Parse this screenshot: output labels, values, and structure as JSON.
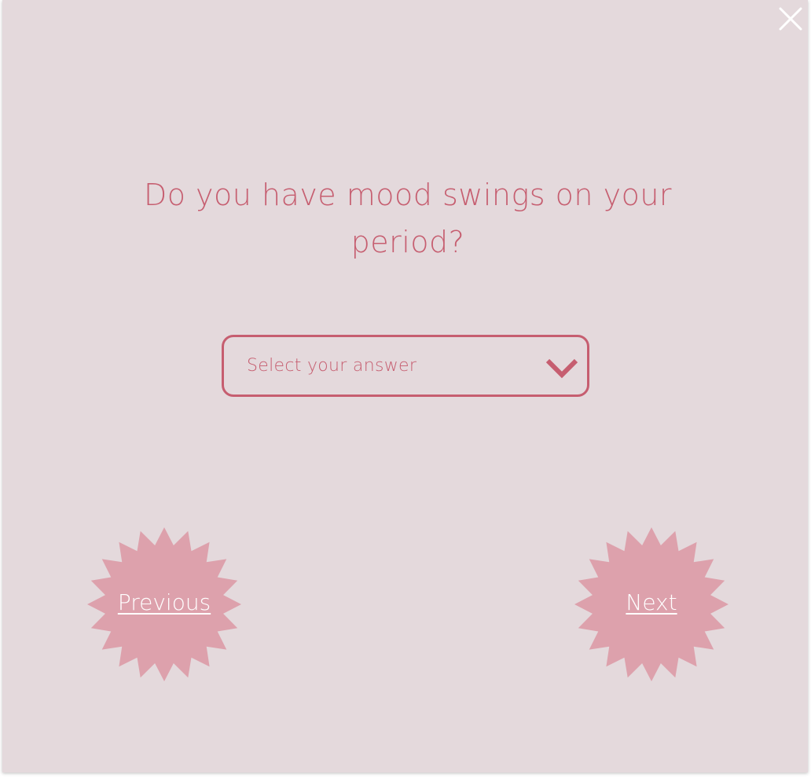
{
  "dialog": {
    "close_icon": "close-icon",
    "question": "Do you have mood swings on your period?",
    "select": {
      "placeholder": "Select your answer",
      "icon": "chevron-down-icon"
    },
    "buttons": {
      "previous_label": "Previous",
      "next_label": "Next"
    }
  },
  "colors": {
    "background": "#e4d9dc",
    "accent": "#c65e70",
    "burst": "#dda1ac",
    "button_text": "#ffffff"
  }
}
